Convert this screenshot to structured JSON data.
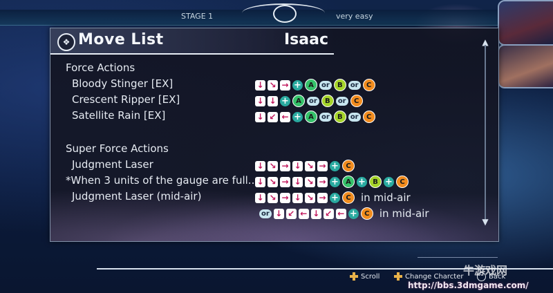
{
  "hud": {
    "stage_label": "STAGE 1",
    "difficulty_label": "very easy"
  },
  "panel": {
    "title": "Move List",
    "character": "Isaac",
    "emblem_icon": "crest-icon"
  },
  "sections": [
    {
      "title": "Force Actions",
      "moves": [
        {
          "name": "Bloody Stinger [EX]",
          "inputs": [
            "down",
            "down-right",
            "right",
            "+",
            "A",
            "or",
            "B",
            "or",
            "C"
          ],
          "suffix": ""
        },
        {
          "name": "Crescent Ripper [EX]",
          "inputs": [
            "down",
            "down",
            "+",
            "A",
            "or",
            "B",
            "or",
            "C"
          ],
          "suffix": ""
        },
        {
          "name": "Satellite Rain [EX]",
          "inputs": [
            "down",
            "down-left",
            "left",
            "+",
            "A",
            "or",
            "B",
            "or",
            "C"
          ],
          "suffix": ""
        }
      ]
    },
    {
      "title": "Super Force Actions",
      "moves": [
        {
          "name": "Judgment Laser",
          "inputs": [
            "down",
            "down-right",
            "right",
            "down",
            "down-right",
            "right",
            "+",
            "C"
          ],
          "suffix": ""
        },
        {
          "name": "*When 3 units of the gauge are full...",
          "inputs": [
            "down",
            "down-right",
            "right",
            "down",
            "down-right",
            "right",
            "+",
            "A",
            "+",
            "B",
            "+",
            "C"
          ],
          "suffix": ""
        },
        {
          "name": "Judgment Laser (mid-air)",
          "inputs": [
            "down",
            "down-right",
            "right",
            "down",
            "down-right",
            "right",
            "+",
            "C"
          ],
          "suffix": "in mid-air"
        },
        {
          "name": "",
          "inputs": [
            "or",
            "down",
            "down-left",
            "left",
            "down",
            "down-left",
            "left",
            "+",
            "C"
          ],
          "suffix": "in mid-air"
        }
      ]
    }
  ],
  "controls": {
    "scroll_label": "Scroll",
    "change_character_label": "Change Charcter",
    "back_label": "Back"
  },
  "watermark": {
    "url": "http://bbs.3dmgame.com/",
    "logo": "牛游戏网"
  },
  "colors": {
    "arrow": "#c0145a",
    "button_a": "#35c26a",
    "button_b": "#a6d42a",
    "button_c": "#f28c1e",
    "plus": "#2aaaa0"
  }
}
